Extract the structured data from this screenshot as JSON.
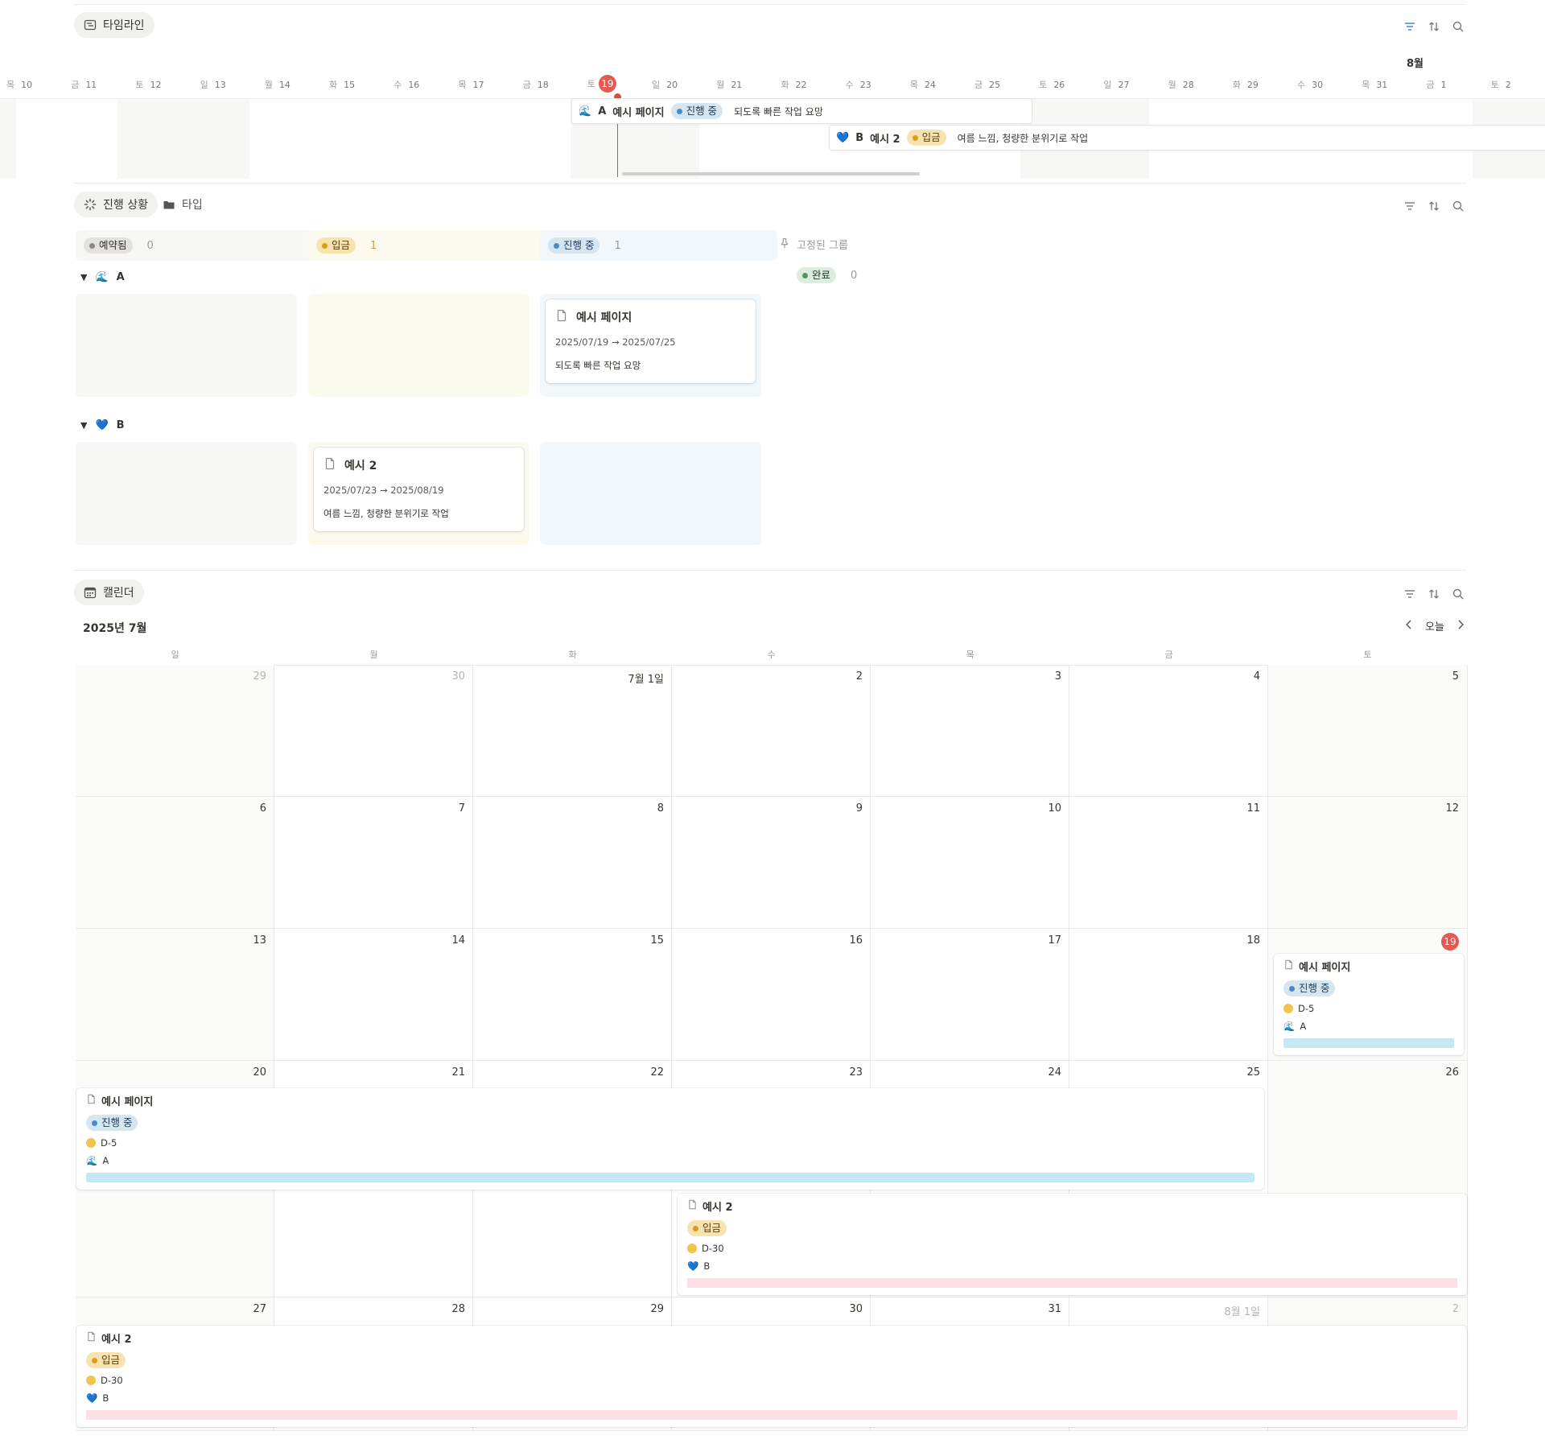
{
  "colors": {
    "accent": "#e25a52",
    "blue_bar": "#c5e8f5",
    "pink_bar": "#fbe0e6",
    "yellow_dot": "#f2c44e"
  },
  "timeline": {
    "tab_label": "타임라인",
    "month_label": "8월",
    "today": "19",
    "days": [
      {
        "w": "목",
        "d": "10"
      },
      {
        "w": "금",
        "d": "11"
      },
      {
        "w": "토",
        "d": "12"
      },
      {
        "w": "일",
        "d": "13"
      },
      {
        "w": "월",
        "d": "14"
      },
      {
        "w": "화",
        "d": "15"
      },
      {
        "w": "수",
        "d": "16"
      },
      {
        "w": "목",
        "d": "17"
      },
      {
        "w": "금",
        "d": "18"
      },
      {
        "w": "토",
        "d": "19"
      },
      {
        "w": "일",
        "d": "20"
      },
      {
        "w": "월",
        "d": "21"
      },
      {
        "w": "화",
        "d": "22"
      },
      {
        "w": "수",
        "d": "23"
      },
      {
        "w": "목",
        "d": "24"
      },
      {
        "w": "금",
        "d": "25"
      },
      {
        "w": "토",
        "d": "26"
      },
      {
        "w": "일",
        "d": "27"
      },
      {
        "w": "월",
        "d": "28"
      },
      {
        "w": "화",
        "d": "29"
      },
      {
        "w": "수",
        "d": "30"
      },
      {
        "w": "목",
        "d": "31"
      },
      {
        "w": "금",
        "d": "1"
      },
      {
        "w": "토",
        "d": "2"
      }
    ],
    "items": [
      {
        "group": "A",
        "title": "예시 페이지",
        "status": "진행 중",
        "note": "되도록 빠른 작업 요망"
      },
      {
        "group": "B",
        "title": "예시 2",
        "status": "입금",
        "note": "여름 느낌, 청량한 분위기로 작업"
      }
    ]
  },
  "board": {
    "tab_label": "진행 상황",
    "tab2_label": "타입",
    "columns": [
      {
        "label": "예약됨",
        "count": "0"
      },
      {
        "label": "입금",
        "count": "1"
      },
      {
        "label": "진행 중",
        "count": "1"
      }
    ],
    "pinned_label": "고정된 그룹",
    "done": {
      "label": "완료",
      "count": "0"
    },
    "groups": [
      {
        "name": "A",
        "card": {
          "title": "예시 페이지",
          "date": "2025/07/19 → 2025/07/25",
          "note": "되도록 빠른 작업 요망"
        }
      },
      {
        "name": "B",
        "card": {
          "title": "예시 2",
          "date": "2025/07/23 → 2025/08/19",
          "note": "여름 느낌, 청량한 분위기로 작업"
        }
      }
    ]
  },
  "calendar": {
    "tab_label": "캘린더",
    "month_title": "2025년 7월",
    "today_button": "오늘",
    "weekdays": [
      "일",
      "월",
      "화",
      "수",
      "목",
      "금",
      "토"
    ],
    "weeks": [
      [
        "29",
        "30",
        "7월 1일",
        "2",
        "3",
        "4",
        "5"
      ],
      [
        "6",
        "7",
        "8",
        "9",
        "10",
        "11",
        "12"
      ],
      [
        "13",
        "14",
        "15",
        "16",
        "17",
        "18",
        "19"
      ],
      [
        "20",
        "21",
        "22",
        "23",
        "24",
        "25",
        "26"
      ],
      [
        "27",
        "28",
        "29",
        "30",
        "31",
        "8월 1일",
        "2"
      ]
    ],
    "events": {
      "e1": {
        "title": "예시 페이지",
        "status": "진행 중",
        "dday": "D-5",
        "group": "A"
      },
      "e2": {
        "title": "예시 2",
        "status": "입금",
        "dday": "D-30",
        "group": "B"
      }
    }
  }
}
